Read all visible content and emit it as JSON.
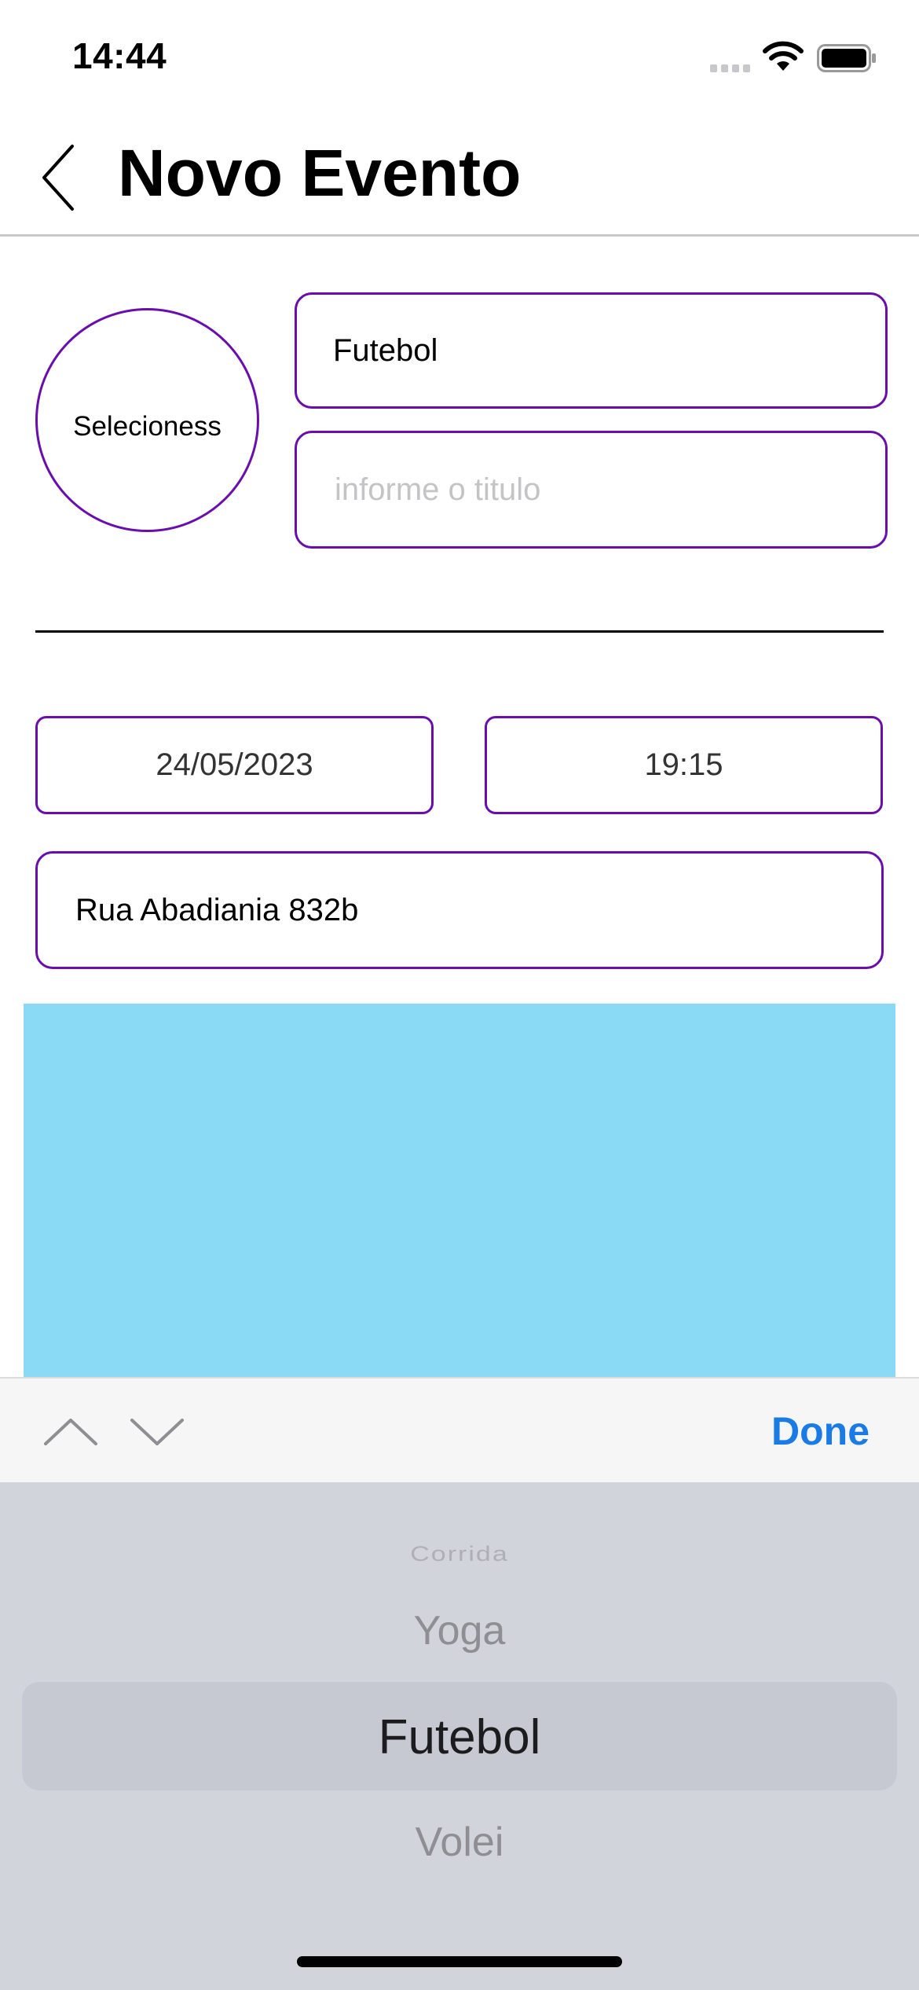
{
  "status_bar": {
    "time": "14:44"
  },
  "nav": {
    "title": "Novo Evento"
  },
  "form": {
    "image_picker_label": "Selecioness",
    "category_value": "Futebol",
    "title_placeholder": "informe o titulo",
    "date_value": "24/05/2023",
    "time_value": "19:15",
    "address_value": "Rua Abadiania 832b"
  },
  "accessory": {
    "done_label": "Done"
  },
  "picker": {
    "options": [
      "Corrida",
      "Yoga",
      "Futebol",
      "Volei"
    ],
    "selected": "Futebol"
  },
  "colors": {
    "accent": "#6a0dad",
    "map": "#8bdaf5",
    "done": "#1a7ae6"
  }
}
